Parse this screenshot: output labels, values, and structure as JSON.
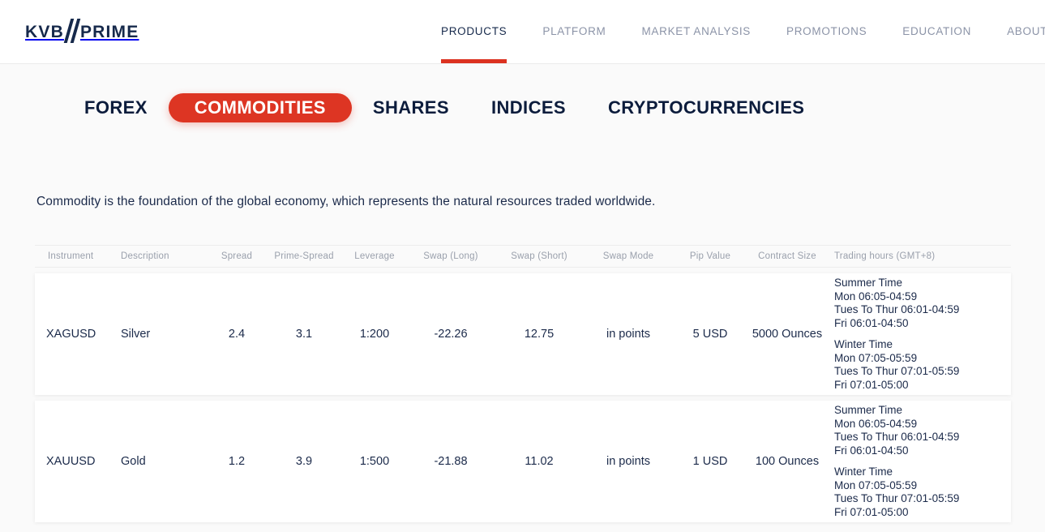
{
  "brand": {
    "name_left": "KVB",
    "name_right": "PRIME",
    "accent_color": "#dc3220",
    "navy_color": "#16294b"
  },
  "nav": {
    "items": [
      {
        "label": "PRODUCTS",
        "active": true
      },
      {
        "label": "PLATFORM",
        "active": false
      },
      {
        "label": "MARKET ANALYSIS",
        "active": false
      },
      {
        "label": "PROMOTIONS",
        "active": false
      },
      {
        "label": "EDUCATION",
        "active": false
      },
      {
        "label": "ABOUT US",
        "active": false
      }
    ]
  },
  "categories": {
    "items": [
      {
        "label": "FOREX",
        "active": false
      },
      {
        "label": "COMMODITIES",
        "active": true
      },
      {
        "label": "SHARES",
        "active": false
      },
      {
        "label": "INDICES",
        "active": false
      },
      {
        "label": "CRYPTOCURRENCIES",
        "active": false
      }
    ]
  },
  "intro": {
    "text": "Commodity is the foundation of the global economy, which represents the natural resources traded worldwide."
  },
  "table": {
    "headers": {
      "instrument": "Instrument",
      "description": "Description",
      "spread": "Spread",
      "prime_spread": "Prime-Spread",
      "leverage": "Leverage",
      "swap_long": "Swap (Long)",
      "swap_short": "Swap (Short)",
      "swap_mode": "Swap Mode",
      "pip_value": "Pip Value",
      "contract_size": "Contract Size",
      "trading_hours": "Trading hours (GMT+8)"
    },
    "rows": [
      {
        "instrument": "XAGUSD",
        "description": "Silver",
        "spread": "2.4",
        "prime_spread": "3.1",
        "leverage": "1:200",
        "swap_long": "-22.26",
        "swap_short": "12.75",
        "swap_mode": "in points",
        "pip_value": "5 USD",
        "contract_size": "5000 Ounces",
        "hours_summer_title": "Summer Time",
        "hours_summer_mon": "Mon 06:05-04:59",
        "hours_summer_tue_thu": "Tues To Thur 06:01-04:59",
        "hours_summer_fri": "Fri 06:01-04:50",
        "hours_winter_title": "Winter Time",
        "hours_winter_mon": "Mon 07:05-05:59",
        "hours_winter_tue_thu": "Tues To Thur 07:01-05:59",
        "hours_winter_fri": "Fri 07:01-05:00"
      },
      {
        "instrument": "XAUUSD",
        "description": "Gold",
        "spread": "1.2",
        "prime_spread": "3.9",
        "leverage": "1:500",
        "swap_long": "-21.88",
        "swap_short": "11.02",
        "swap_mode": "in points",
        "pip_value": "1 USD",
        "contract_size": "100 Ounces",
        "hours_summer_title": "Summer Time",
        "hours_summer_mon": "Mon 06:05-04:59",
        "hours_summer_tue_thu": "Tues To Thur 06:01-04:59",
        "hours_summer_fri": "Fri 06:01-04:50",
        "hours_winter_title": "Winter Time",
        "hours_winter_mon": "Mon 07:05-05:59",
        "hours_winter_tue_thu": "Tues To Thur 07:01-05:59",
        "hours_winter_fri": "Fri 07:01-05:00"
      }
    ]
  }
}
